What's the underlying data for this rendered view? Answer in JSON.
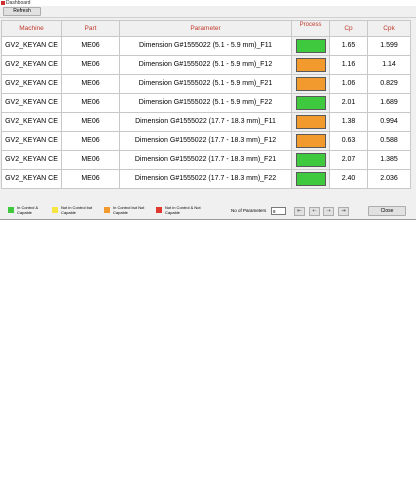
{
  "window": {
    "title": "Dashboard"
  },
  "toolbar": {
    "refresh_label": "Refresh"
  },
  "table": {
    "headers": {
      "machine": "Machine",
      "part": "Part",
      "parameter": "Parameter",
      "process": "Process",
      "cp": "Cp",
      "cpk": "Cpk"
    },
    "rows": [
      {
        "machine": "GV2_KEYAN CE",
        "part": "ME06",
        "parameter": "Dimension G#1555022  (5.1 - 5.9 mm)_F11",
        "status": "green",
        "cp": "1.65",
        "cpk": "1.599"
      },
      {
        "machine": "GV2_KEYAN CE",
        "part": "ME06",
        "parameter": "Dimension G#1555022  (5.1 - 5.9 mm)_F12",
        "status": "orange",
        "cp": "1.16",
        "cpk": "1.14"
      },
      {
        "machine": "GV2_KEYAN CE",
        "part": "ME06",
        "parameter": "Dimension G#1555022  (5.1 - 5.9 mm)_F21",
        "status": "orange",
        "cp": "1.06",
        "cpk": "0.829"
      },
      {
        "machine": "GV2_KEYAN CE",
        "part": "ME06",
        "parameter": "Dimension G#1555022  (5.1 - 5.9 mm)_F22",
        "status": "green",
        "cp": "2.01",
        "cpk": "1.689"
      },
      {
        "machine": "GV2_KEYAN CE",
        "part": "ME06",
        "parameter": "Dimension G#1555022  (17.7 - 18.3 mm)_F11",
        "status": "orange",
        "cp": "1.38",
        "cpk": "0.994"
      },
      {
        "machine": "GV2_KEYAN CE",
        "part": "ME06",
        "parameter": "Dimension G#1555022  (17.7 - 18.3 mm)_F12",
        "status": "orange",
        "cp": "0.63",
        "cpk": "0.588"
      },
      {
        "machine": "GV2_KEYAN CE",
        "part": "ME06",
        "parameter": "Dimension G#1555022  (17.7 - 18.3 mm)_F21",
        "status": "green",
        "cp": "2.07",
        "cpk": "1.385"
      },
      {
        "machine": "GV2_KEYAN CE",
        "part": "ME06",
        "parameter": "Dimension G#1555022  (17.7 - 18.3 mm)_F22",
        "status": "green",
        "cp": "2.40",
        "cpk": "2.036"
      }
    ]
  },
  "legend": [
    {
      "label": "In Control & Capable",
      "color": "#3ec93e"
    },
    {
      "label": "Not in Control but Capable",
      "color": "#f5e642"
    },
    {
      "label": "In Control but Not Capable",
      "color": "#f39a2e"
    },
    {
      "label": "Not in Control & Not Capable",
      "color": "#e03a2f"
    }
  ],
  "status_colors": {
    "green": "#3ec93e",
    "orange": "#f39a2e"
  },
  "footer": {
    "params_label": "No of Parameters",
    "params_value": "8",
    "nav_icons": [
      "first-page-icon",
      "previous-page-icon",
      "next-page-icon",
      "last-page-icon"
    ],
    "close_label": "Close"
  }
}
